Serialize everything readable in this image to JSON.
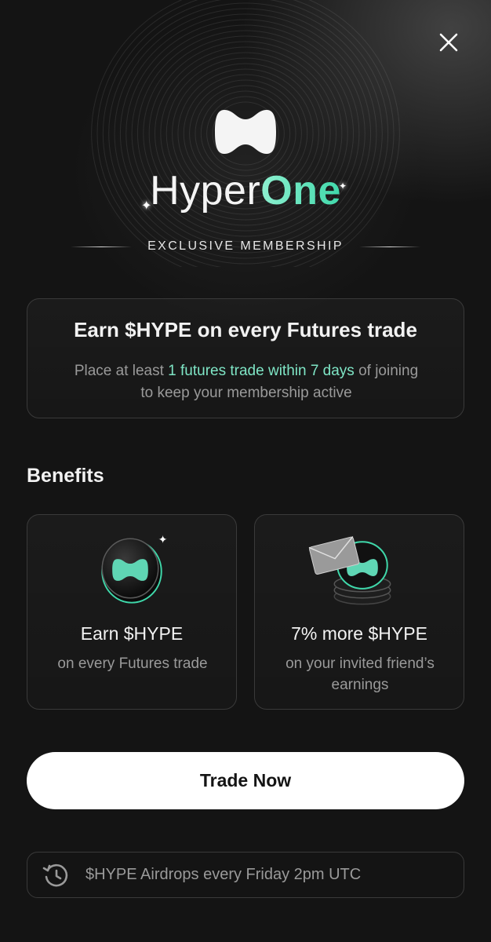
{
  "header": {
    "close_icon": "close-icon",
    "brand_part_1": "Hyper",
    "brand_part_2": "One",
    "membership_label": "EXCLUSIVE MEMBERSHIP"
  },
  "earn_card": {
    "title": "Earn $HYPE on every Futures trade",
    "desc_prefix": "Place at least ",
    "desc_highlight": "1 futures trade within 7 days",
    "desc_suffix": " of joining to keep your membership active"
  },
  "benefits": {
    "heading": "Benefits",
    "items": [
      {
        "icon": "hype-coin-icon",
        "title": "Earn $HYPE",
        "subtitle": "on every Futures trade"
      },
      {
        "icon": "envelope-coins-icon",
        "title": "7% more $HYPE",
        "subtitle": "on your invited friend’s earnings"
      }
    ]
  },
  "cta": {
    "label": "Trade Now"
  },
  "airdrop": {
    "icon": "history-clock-icon",
    "text": "$HYPE Airdrops every Friday 2pm UTC"
  },
  "colors": {
    "accent": "#7fe6c6",
    "background": "#141414",
    "button_bg": "#ffffff"
  }
}
